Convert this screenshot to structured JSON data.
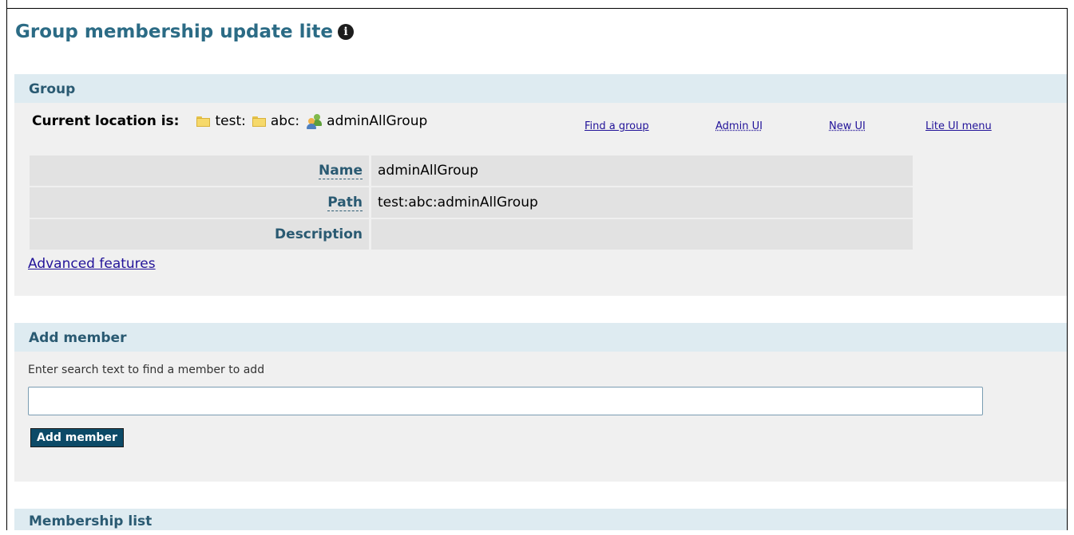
{
  "page": {
    "title": "Group membership update lite"
  },
  "group_section": {
    "header": "Group",
    "location_label": "Current location is:",
    "breadcrumb": [
      "test:",
      "abc:",
      "adminAllGroup"
    ],
    "links": {
      "find_group": "Find a group",
      "admin_ui": "Admin UI",
      "new_ui": "New UI",
      "lite_ui_menu": "Lite UI menu"
    },
    "properties": [
      {
        "label": "Name",
        "value": "adminAllGroup"
      },
      {
        "label": "Path",
        "value": "test:abc:adminAllGroup"
      },
      {
        "label": "Description",
        "value": ""
      }
    ],
    "advanced_link": "Advanced features"
  },
  "add_member_section": {
    "header": "Add member",
    "hint": "Enter search text to find a member to add",
    "search_value": "",
    "button_label": "Add member"
  },
  "membership_section": {
    "header": "Membership list"
  },
  "colors": {
    "title": "#2b6b85",
    "section_header_bg": "#deebf1",
    "section_bg": "#f0f0f0",
    "button_bg": "#0c4a67",
    "link": "#221399"
  },
  "icons": [
    "info-icon",
    "folder-icon",
    "group-icon"
  ]
}
